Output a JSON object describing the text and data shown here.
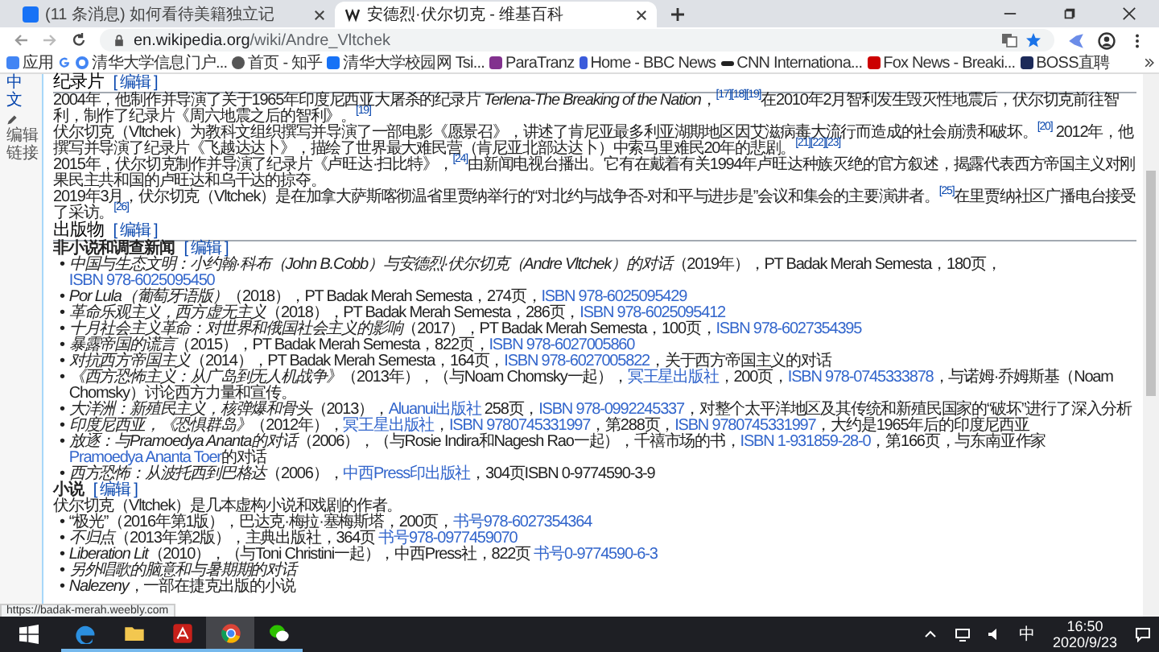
{
  "tabs": [
    {
      "label": "(11 条消息) 如何看待美籍独立记",
      "selected": false
    },
    {
      "label": "安德烈·伏尔切克 - 维基百科",
      "selected": true
    }
  ],
  "address": {
    "host": "en.wikipedia.org",
    "path": "/wiki/Andre_Vltchek"
  },
  "bookmarks": [
    {
      "label": "应用"
    },
    {
      "label": "清华大学信息门户..."
    },
    {
      "label": "首页 - 知乎"
    },
    {
      "label": "清华大学校园网 Tsi..."
    },
    {
      "label": "ParaTranz"
    },
    {
      "label": "Home - BBC News"
    },
    {
      "label": "CNN Internationa..."
    },
    {
      "label": "Fox News - Breaki..."
    },
    {
      "label": "BOSS直聘"
    }
  ],
  "sidebar": {
    "language": "中文",
    "edit_links": "编辑链接"
  },
  "blocks": [
    {
      "kind": "section",
      "title": "纪录片",
      "edit": "[ 编辑 ]"
    },
    {
      "kind": "paragraph",
      "text": "2004年，他制作并导演了关于1965年印度尼西亚大屠杀的纪录片 *Terlena-The Breaking of the Nation*，$^{[17][18][19]}$在2010年2月智利发生毁灭性地震后，伏尔切克前往智利，制作了纪录片《周六地震之后的智利》。$^{[19]}$"
    },
    {
      "kind": "paragraph",
      "text": "伏尔切克（Vltchek）为教科文组织撰写并导演了一部电影《愿景召》，讲述了肯尼亚最多利亚湖期地区因艾滋病毒大流行而造成的社会崩溃和破坏。$^{[20]}$ 2012年，他撰写并导演了纪录片《飞越达达卜》，描绘了世界最大难民营（肯尼亚北部达达卜）中索马里难民20年的悲剧。$^{[21][22][23]}$"
    },
    {
      "kind": "paragraph",
      "text": "2015年，伏尔切克制作并导演了纪录片《卢旺达·扫比特》，$^{[24]}$由新闻电视台播出。它有在戴着有关1994年卢旺达种族灭绝的官方叙述，揭露代表西方帝国主义对刚果民主共和国的卢旺达和乌干达的掠夺。"
    },
    {
      "kind": "paragraph",
      "text": "2019年3月，伏尔切克（Vltchek）是在加拿大萨斯喀彻温省里贾纳举行的“对北约与战争否-对和平与进步是”会议和集会的主要演讲者。$^{[25]}$在里贾纳社区广播电台接受了采访。$^{[26]}$"
    },
    {
      "kind": "section",
      "title": "出版物",
      "edit": "[ 编辑 ]"
    },
    {
      "kind": "subsection",
      "title": "非小说和调查新闻",
      "edit": "[ 编辑 ]"
    },
    {
      "kind": "list",
      "bullet": "•",
      "items": [
        {
          "parts": [
            {
              "kind": "title",
              "text": "中国与生态文明：小约翰·科布（John B.Cobb）与安德烈·伏尔切克（Andre Vltchek）的对话"
            },
            {
              "kind": "text",
              "text": "（2019年），PT Badak Merah Semesta，180页，"
            },
            {
              "kind": "link",
              "text": "ISBN 978-6025095450"
            }
          ]
        },
        {
          "parts": [
            {
              "kind": "title",
              "text": "Por Lula（葡萄牙语版）"
            },
            {
              "kind": "text",
              "text": "（2018），PT Badak Merah Semesta，274页，"
            },
            {
              "kind": "link",
              "text": "ISBN 978-6025095429"
            }
          ]
        },
        {
          "parts": [
            {
              "kind": "title",
              "text": "革命乐观主义，西方虚无主义"
            },
            {
              "kind": "text",
              "text": "（2018），PT Badak Merah Semesta，286页，"
            },
            {
              "kind": "link",
              "text": "ISBN 978-6025095412"
            }
          ]
        },
        {
          "parts": [
            {
              "kind": "title",
              "text": "十月社会主义革命：对世界和俄国社会主义的影响"
            },
            {
              "kind": "text",
              "text": "（2017），PT Badak Merah Semesta，100页，"
            },
            {
              "kind": "link",
              "text": "ISBN 978-6027354395"
            }
          ]
        },
        {
          "parts": [
            {
              "kind": "title",
              "text": "暴露帝国的谎言"
            },
            {
              "kind": "text",
              "text": "（2015），PT Badak Merah Semesta，822页，"
            },
            {
              "kind": "link",
              "text": "ISBN 978-6027005860"
            }
          ]
        },
        {
          "parts": [
            {
              "kind": "title",
              "text": "对抗西方帝国主义"
            },
            {
              "kind": "text",
              "text": "（2014），PT Badak Merah Semesta，164页，"
            },
            {
              "kind": "link",
              "text": "ISBN 978-6027005822"
            },
            {
              "kind": "text",
              "text": "，关于西方帝国主义的对话"
            }
          ]
        },
        {
          "parts": [
            {
              "kind": "title",
              "text": "《西方恐怖主义：从广岛到无人机战争》"
            },
            {
              "kind": "text",
              "text": "（2013年），（与Noam Chomsky一起），"
            },
            {
              "kind": "link",
              "text": "冥王星出版社"
            },
            {
              "kind": "text",
              "text": "，200页，"
            },
            {
              "kind": "link",
              "text": "ISBN 978-0745333878"
            },
            {
              "kind": "text",
              "text": "，与诺姆·乔姆斯基（Noam Chomsky）讨论西方力量和宣传。"
            }
          ]
        },
        {
          "parts": [
            {
              "kind": "title",
              "text": "大洋洲：新殖民主义，核弹爆和骨头"
            },
            {
              "kind": "text",
              "text": "（2013），"
            },
            {
              "kind": "link",
              "text": "Aluanui出版社"
            },
            {
              "kind": "text",
              "text": " 258页，"
            },
            {
              "kind": "link",
              "text": "ISBN 978-0992245337"
            },
            {
              "kind": "text",
              "text": "，对整个太平洋地区及其传统和新殖民国家的“破坏”进行了深入分析"
            }
          ]
        },
        {
          "parts": [
            {
              "kind": "title",
              "text": "印度尼西亚，《恐惧群岛》"
            },
            {
              "kind": "text",
              "text": "（2012年），"
            },
            {
              "kind": "link",
              "text": "冥王星出版社"
            },
            {
              "kind": "text",
              "text": "，"
            },
            {
              "kind": "link",
              "text": "ISBN 9780745331997"
            },
            {
              "kind": "text",
              "text": "，第288页，"
            },
            {
              "kind": "link",
              "text": "ISBN 9780745331997"
            },
            {
              "kind": "text",
              "text": "，大约是1965年后的印度尼西亚"
            }
          ]
        },
        {
          "parts": [
            {
              "kind": "title",
              "text": "放逐：与Pramoedya Ananta的对话"
            },
            {
              "kind": "text",
              "text": "（2006），（与Rosie Indira和Nagesh Rao一起），千禧市场的书，"
            },
            {
              "kind": "link",
              "text": "ISBN 1-931859-28-0"
            },
            {
              "kind": "text",
              "text": "，第166页，与东南亚作家"
            },
            {
              "kind": "link",
              "text": "Pramoedya Ananta Toer"
            },
            {
              "kind": "text",
              "text": "的对话"
            }
          ]
        },
        {
          "parts": [
            {
              "kind": "title",
              "text": "西方恐怖：从波托西到巴格达"
            },
            {
              "kind": "text",
              "text": "（2006），"
            },
            {
              "kind": "link",
              "text": "中西Press印出版社"
            },
            {
              "kind": "text",
              "text": "，304页ISBN 0-9774590-3-9"
            }
          ]
        }
      ]
    },
    {
      "kind": "subsection",
      "title": "小说",
      "edit": "[ 编辑 ]"
    },
    {
      "kind": "paragraph",
      "text": "伏尔切克（Vltchek）是几本虚构小说和戏剧的作者。"
    },
    {
      "kind": "list",
      "bullet": "•",
      "items": [
        {
          "parts": [
            {
              "kind": "text",
              "text": "“极光”（2016年第1版），巴达克·梅拉·塞梅斯塔，200页，"
            },
            {
              "kind": "link",
              "text": "书号978-6027354364"
            }
          ]
        },
        {
          "parts": [
            {
              "kind": "title",
              "text": "不归点"
            },
            {
              "kind": "text",
              "text": "（2013年第2版），主典出版社，364页 "
            },
            {
              "kind": "link",
              "text": "书号978-0977459070"
            }
          ]
        },
        {
          "parts": [
            {
              "kind": "title",
              "text": "Liberation Lit"
            },
            {
              "kind": "text",
              "text": "（2010），（与Toni Christini一起），中西Press社，822页 "
            },
            {
              "kind": "link",
              "text": "书号0-9774590-6-3"
            }
          ]
        },
        {
          "parts": [
            {
              "kind": "title",
              "text": "另外唱歌的脑意和与暑期期的对话"
            }
          ]
        },
        {
          "parts": [
            {
              "kind": "title",
              "text": "Nalezeny"
            },
            {
              "kind": "text",
              "text": "，一部在捷克出版的小说"
            }
          ]
        }
      ]
    }
  ],
  "status_url": "https://badak-merah.weebly.com",
  "taskbar": {
    "apps": [
      {
        "active": false
      },
      {
        "active": false
      },
      {
        "active": false
      },
      {
        "active": true
      },
      {
        "active": false
      }
    ],
    "ime": "中",
    "time": "16:50",
    "date": "2020/9/23"
  }
}
